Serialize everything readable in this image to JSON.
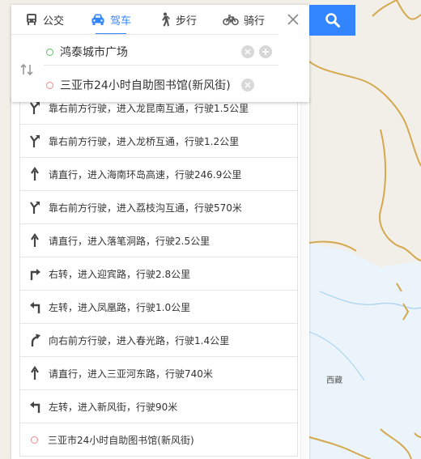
{
  "tabs": [
    {
      "label": "公交",
      "icon": "bus-icon"
    },
    {
      "label": "驾车",
      "icon": "car-icon",
      "active": true
    },
    {
      "label": "步行",
      "icon": "walk-icon"
    },
    {
      "label": "骑行",
      "icon": "bike-icon"
    }
  ],
  "start": {
    "value": "鸿泰城市广场"
  },
  "end": {
    "value": "三亚市24小时自助图书馆(新风街)"
  },
  "steps": [
    {
      "text": "靠右前方行驶，进入龙昆南互通，行驶1.5公里",
      "icon": "keep-right-icon"
    },
    {
      "text": "靠右前方行驶，进入龙桥互通，行驶1.2公里",
      "icon": "keep-right-icon"
    },
    {
      "text": "请直行，进入海南环岛高速，行驶246.9公里",
      "icon": "straight-icon"
    },
    {
      "text": "靠右前方行驶，进入荔枝沟互通，行驶570米",
      "icon": "keep-right-icon"
    },
    {
      "text": "请直行，进入落笔洞路，行驶2.5公里",
      "icon": "straight-icon"
    },
    {
      "text": "右转，进入迎宾路，行驶2.8公里",
      "icon": "turn-right-icon"
    },
    {
      "text": "左转，进入凤凰路，行驶1.0公里",
      "icon": "turn-left-icon"
    },
    {
      "text": "向右前方行驶，进入春光路，行驶1.4公里",
      "icon": "bear-right-icon"
    },
    {
      "text": "请直行，进入三亚河东路，行驶740米",
      "icon": "straight-icon"
    },
    {
      "text": "左转，进入新风街，行驶90米",
      "icon": "turn-left-icon"
    }
  ],
  "destination": {
    "text": "三亚市24小时自助图书馆(新风街)"
  },
  "map": {
    "label": "西藏"
  },
  "colors": {
    "accent": "#3385ff",
    "start_dot": "#59c35a",
    "end_dot": "#ef8a8a",
    "border_line": "#d4a84e",
    "water": "#a8d0ea"
  }
}
